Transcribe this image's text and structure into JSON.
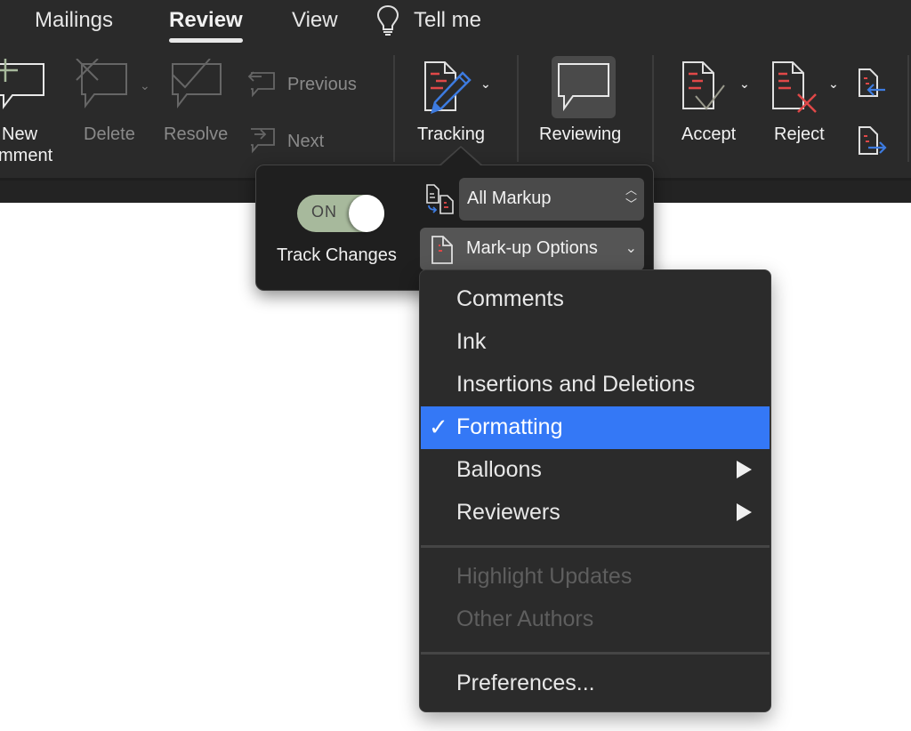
{
  "tabs": [
    {
      "label": "Mailings",
      "active": false
    },
    {
      "label": "Review",
      "active": true
    },
    {
      "label": "View",
      "active": false
    }
  ],
  "tell_me": {
    "label": "Tell me",
    "icon": "lightbulb-icon"
  },
  "ribbon": {
    "new_comment": {
      "line1": "New",
      "line2": "mment",
      "icon": "new-comment-icon"
    },
    "delete": {
      "label": "Delete",
      "icon": "delete-comment-icon",
      "enabled": false
    },
    "resolve": {
      "label": "Resolve",
      "icon": "resolve-comment-icon",
      "enabled": false
    },
    "previous": {
      "label": "Previous",
      "icon": "previous-comment-icon",
      "enabled": false
    },
    "next": {
      "label": "Next",
      "icon": "next-comment-icon",
      "enabled": false
    },
    "tracking": {
      "label": "Tracking",
      "icon": "tracking-pencil-icon"
    },
    "reviewing": {
      "label": "Reviewing",
      "icon": "reviewing-comment-icon",
      "pressed": true
    },
    "accept": {
      "label": "Accept",
      "icon": "accept-change-icon"
    },
    "reject": {
      "label": "Reject",
      "icon": "reject-change-icon"
    },
    "previous_change": {
      "icon": "previous-change-icon"
    },
    "next_change": {
      "icon": "next-change-icon"
    }
  },
  "tracking_popover": {
    "toggle": {
      "state_text": "ON",
      "on": true
    },
    "toggle_label": "Track Changes",
    "display_for_review": {
      "value": "All Markup",
      "icon": "compare-markup-icon"
    },
    "markup_options": {
      "label": "Mark-up Options",
      "icon": "markup-document-icon"
    }
  },
  "markup_menu": {
    "items": [
      {
        "label": "Comments",
        "checked": false,
        "enabled": true,
        "submenu": false
      },
      {
        "label": "Ink",
        "checked": false,
        "enabled": true,
        "submenu": false
      },
      {
        "label": "Insertions and Deletions",
        "checked": false,
        "enabled": true,
        "submenu": false
      },
      {
        "label": "Formatting",
        "checked": true,
        "enabled": true,
        "submenu": false,
        "highlighted": true
      },
      {
        "label": "Balloons",
        "checked": false,
        "enabled": true,
        "submenu": true
      },
      {
        "label": "Reviewers",
        "checked": false,
        "enabled": true,
        "submenu": true
      },
      {
        "label": "Highlight Updates",
        "checked": false,
        "enabled": false,
        "submenu": false
      },
      {
        "label": "Other Authors",
        "checked": false,
        "enabled": false,
        "submenu": false
      },
      {
        "label": "Preferences...",
        "checked": false,
        "enabled": true,
        "submenu": false
      }
    ],
    "check_glyph": "✓"
  },
  "colors": {
    "ribbon_bg": "#2a2a2a",
    "accent_blue": "#3478f6",
    "toggle_green": "#a7b99c",
    "markup_red": "#e04848",
    "arrow_blue": "#3d7be0"
  }
}
